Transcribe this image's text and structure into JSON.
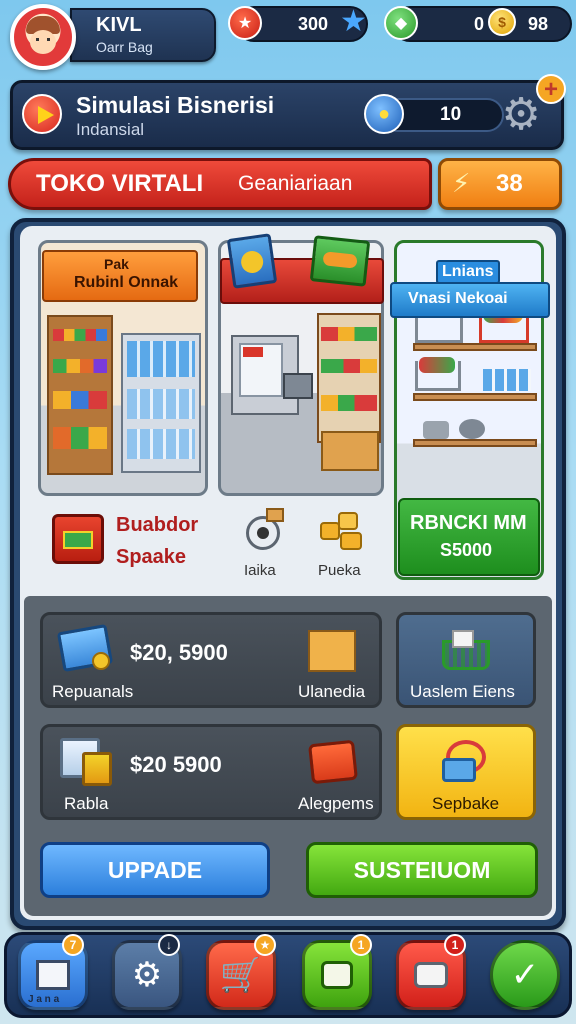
{
  "player": {
    "title": "KIVL",
    "subtitle": "Oarr Bag"
  },
  "resources": {
    "stars_value": "300",
    "coins_value": "0",
    "gems_value": "98"
  },
  "simulation": {
    "title": "Simulasi Bisnerisi",
    "subtitle": "Indansial",
    "value": "10"
  },
  "store": {
    "title": "TOKO VIRTALI",
    "subtitle": "Geaniariaan",
    "coin_value": "38"
  },
  "scenes": {
    "first": {
      "line1": "Pak",
      "line2": "Rubinl Onnak"
    },
    "third": {
      "line1": "Lnians",
      "line2": "Vnasi Nekoai"
    }
  },
  "items": {
    "item_a_line1": "Buabdor",
    "item_a_line2": "Spaake",
    "item_b_label": "Iaika",
    "item_c_label": "Pueka",
    "promo_line1": "RBNCKI MM",
    "promo_line2": "S5000"
  },
  "cards": [
    {
      "price": "$20, 5900",
      "left_label": "Repuanals",
      "right_label": "Ulanedia"
    },
    {
      "price": "$20 5900",
      "left_label": "Rabla",
      "right_label": "Alegpems"
    }
  ],
  "side_cards": {
    "top_label": "Uaslem Eiens",
    "bottom_label": "Sepbake"
  },
  "buttons": {
    "upgrade": "UPPADE",
    "sustain": "SUSTEIUOM"
  },
  "nav": {
    "first_caption": "J a n a",
    "badges": [
      "7",
      "",
      "",
      "1",
      "1"
    ]
  },
  "colors": {
    "accent_red": "#d7261e",
    "accent_orange": "#f07f12",
    "accent_green": "#43a911",
    "accent_blue": "#2c7fdc",
    "panel_navy": "#1a2c4a"
  },
  "icons": {
    "star": "star-icon",
    "coin": "coin-icon",
    "gem": "gem-icon",
    "gear": "gear-icon",
    "cart": "cart-icon"
  }
}
